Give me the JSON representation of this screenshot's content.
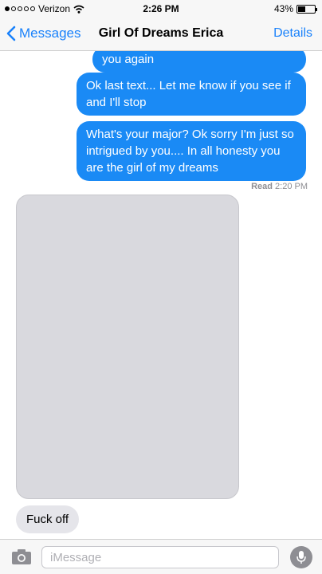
{
  "status_bar": {
    "carrier": "Verizon",
    "time": "2:26 PM",
    "battery": "43%",
    "battery_level": 0.43
  },
  "nav": {
    "back_label": "Messages",
    "title": "Girl Of Dreams Erica",
    "details_label": "Details"
  },
  "messages": [
    {
      "direction": "outgoing",
      "text": "you again"
    },
    {
      "direction": "outgoing",
      "text": "Ok last text... Let me know if you see if and I'll stop"
    },
    {
      "direction": "outgoing",
      "text": "What's your major? Ok sorry I'm just so intrigued by you.... In all honesty you are the girl of my dreams"
    },
    {
      "direction": "incoming",
      "type": "photo"
    },
    {
      "direction": "incoming",
      "text": "Fuck off"
    }
  ],
  "read_receipt": {
    "label": "Read",
    "time": "2:20 PM"
  },
  "input": {
    "placeholder": "iMessage"
  },
  "colors": {
    "accent": "#1a82fb",
    "outgoing_bubble": "#1a8af5",
    "incoming_bubble": "#e5e5ea"
  },
  "icons": [
    "wifi-icon",
    "chevron-left-icon",
    "camera-icon",
    "microphone-icon"
  ]
}
